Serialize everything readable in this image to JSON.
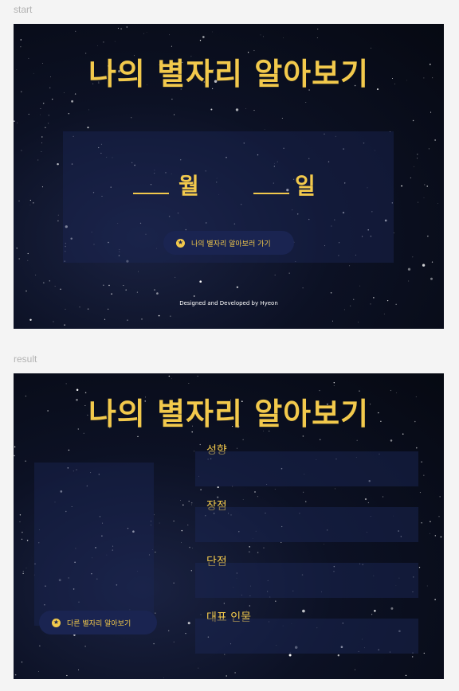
{
  "labels": {
    "start": "start",
    "result": "result"
  },
  "colors": {
    "accent": "#f2c94c",
    "button_bg": "#1a2451",
    "text_light": "#ffffff"
  },
  "start": {
    "title": "나의 별자리 알아보기",
    "month_label": "월",
    "day_label": "일",
    "button_icon": "star-circle-icon",
    "button_label": "나의 별자리 알아보러 가기",
    "credit": "Designed and Developed by Hyeon"
  },
  "result": {
    "title": "나의 별자리 알아보기",
    "sections": [
      {
        "label": "성향"
      },
      {
        "label": "장점"
      },
      {
        "label": "단점"
      },
      {
        "label": "대표 인물"
      }
    ],
    "button_icon": "star-circle-icon",
    "button_label": "다른 별자리 알아보기"
  }
}
